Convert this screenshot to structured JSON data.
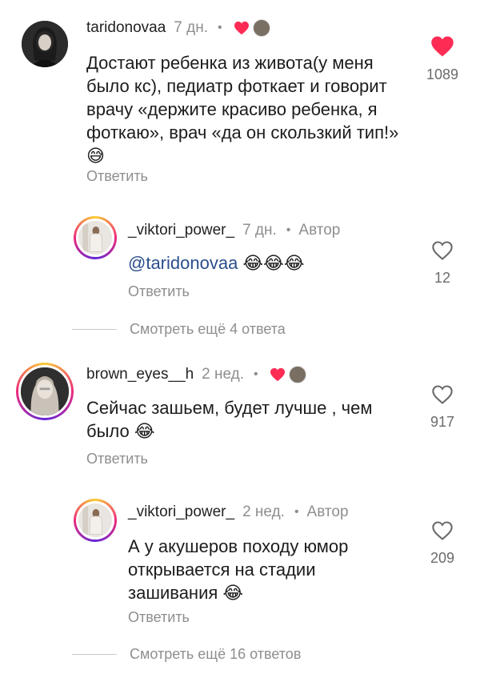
{
  "comments": [
    {
      "username": "taridonovaa",
      "time": "7 дн.",
      "text": "Достают ребенка из живота(у меня было кс), педиатр фоткает и говорит врачу «держите красиво ребенка, я фоткаю», врач «да он скользкий тип!» 😅",
      "reply_label": "Ответить",
      "likes": "1089",
      "liked": true
    },
    {
      "username": "_viktori_power_",
      "time": "7 дн.",
      "author_badge": "Автор",
      "mention": "@taridonovaa",
      "text_suffix": " 😂😂😂",
      "reply_label": "Ответить",
      "likes": "12",
      "liked": false
    },
    {
      "username": "brown_eyes__h",
      "time": "2 нед.",
      "text": "Сейчас зашьем, будет лучше , чем было 😂",
      "reply_label": "Ответить",
      "likes": "917",
      "liked": false
    },
    {
      "username": "_viktori_power_",
      "time": "2 нед.",
      "author_badge": "Автор",
      "text": "А у акушеров походу юмор открывается на стадии зашивания 😂",
      "reply_label": "Ответить",
      "likes": "209",
      "liked": false
    }
  ],
  "more_replies": [
    "Смотреть ещё 4 ответа",
    "Смотреть ещё 16 ответов"
  ],
  "colors": {
    "like_red": "#fe2c55",
    "muted_gray": "#8e8e8e",
    "mention_blue": "#2b4e8c"
  }
}
